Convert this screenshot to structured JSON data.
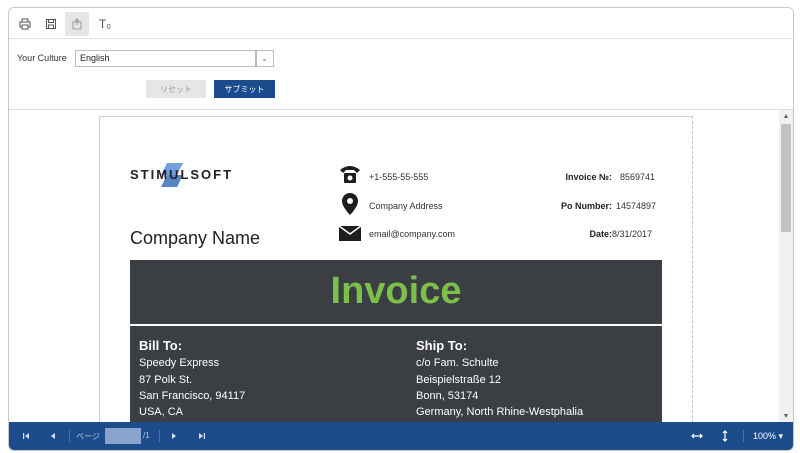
{
  "toolbar": {
    "items": [
      {
        "name": "print-button",
        "icon": "printer-icon"
      },
      {
        "name": "save-button",
        "icon": "floppy-disk-icon"
      },
      {
        "name": "send-email-button",
        "icon": "export-icon"
      },
      {
        "name": "parameters-button",
        "icon": "text-size-icon",
        "glyph": "T₀"
      }
    ]
  },
  "params": {
    "culture_label": "Your Culture",
    "culture_value": "English",
    "reset_label": "リセット",
    "submit_label": "サブミット"
  },
  "report": {
    "logo_text": "STIMULSOFT",
    "company_name": "Company Name",
    "phone": "+1-555-55-555",
    "address": "Company Address",
    "email": "email@company.com",
    "invoice_no_label": "Invoice №:",
    "invoice_no": "8569741",
    "po_number_label": "Po Number:",
    "po_number": "14574897",
    "date_label": "Date:",
    "date": "8/31/2017",
    "title": "Invoice",
    "bill_to": {
      "title": "Bill To:",
      "lines": [
        "Speedy Express",
        "87 Polk St.",
        "San Francisco, 94117",
        "USA, CA"
      ]
    },
    "ship_to": {
      "title": "Ship To:",
      "lines": [
        "c/o Fam. Schulte",
        "Beispielstraße 12",
        "Bonn, 53174",
        "Germany, North Rhine-Westphalia"
      ]
    }
  },
  "footer": {
    "page_label": "ページ",
    "page_of": "/1",
    "zoom": "100% ▾"
  },
  "colors": {
    "accent": "#1c4c8c",
    "invoice_green": "#7cbf4a",
    "band": "#3b3e42"
  }
}
